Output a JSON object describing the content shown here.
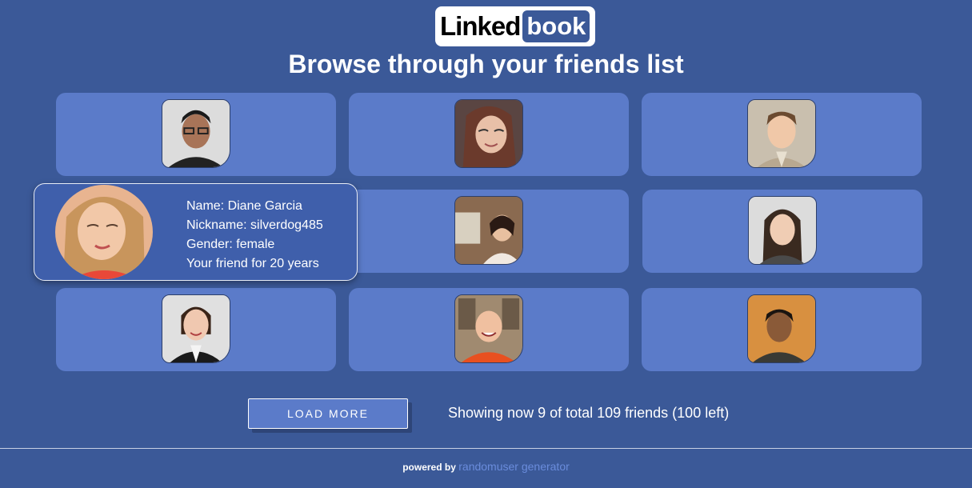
{
  "logo": {
    "part1": "Linked",
    "part2": "book"
  },
  "page_title": "Browse through your friends list",
  "profile": {
    "name": "Name: Diane Garcia",
    "nickname": "Nickname: silverdog485",
    "gender": "Gender: female",
    "friend_for": "Your friend for 20 years"
  },
  "load_more_label": "LOAD MORE",
  "status": "Showing now 9 of total 109 friends (100 left)",
  "footer": {
    "powered_by": "powered by",
    "link_text": "randomuser generator"
  },
  "colors": {
    "background": "#3b5998",
    "card": "#5b7bc9",
    "link": "#6a8cdc"
  }
}
